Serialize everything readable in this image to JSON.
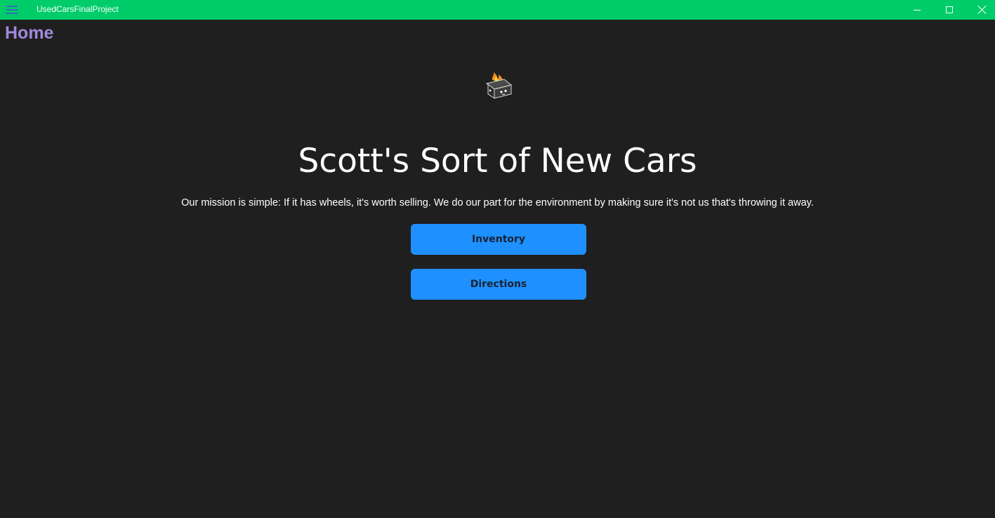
{
  "window": {
    "title": "UsedCarsFinalProject",
    "accent_color": "#00cc6a",
    "menu_icon": "hamburger-menu-icon",
    "controls": [
      "minimize-icon",
      "maximize-icon",
      "close-icon"
    ]
  },
  "page": {
    "header": "Home",
    "header_color": "#a088dc",
    "logo_icon": "burning-dumpster-icon",
    "title": "Scott's Sort of New Cars",
    "mission": "Our mission is simple: If it has wheels, it's worth selling. We do our part for the environment by making sure it's not us that's throwing it away."
  },
  "buttons": {
    "inventory_label": "Inventory",
    "directions_label": "Directions",
    "color": "#1e90ff"
  }
}
